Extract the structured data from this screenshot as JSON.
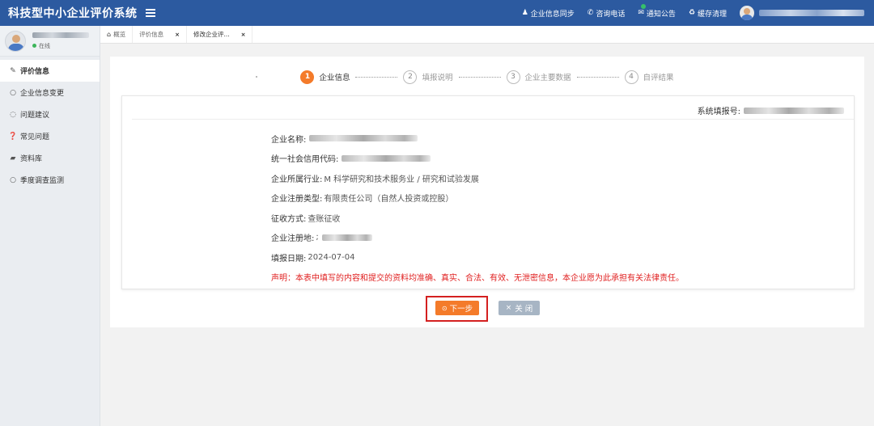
{
  "header": {
    "title": "科技型中小企业评价系统",
    "nav": [
      {
        "icon": "user-icon",
        "glyph": "♟",
        "label": "企业信息同步"
      },
      {
        "icon": "phone-icon",
        "glyph": "✆",
        "label": "咨询电话"
      },
      {
        "icon": "mail-icon",
        "glyph": "✉",
        "label": "通知公告"
      },
      {
        "icon": "refresh-icon",
        "glyph": "♻",
        "label": "缓存清理"
      }
    ]
  },
  "sidebar": {
    "status": "在线",
    "items": [
      {
        "glyph": "✎",
        "label": "评价信息"
      },
      {
        "glyph": "○",
        "label": "企业信息变更"
      },
      {
        "glyph": "◌",
        "label": "问题建议"
      },
      {
        "glyph": "❓",
        "label": "常见问题"
      },
      {
        "glyph": "▰",
        "label": "资料库"
      },
      {
        "glyph": "○",
        "label": "季度调查监测"
      }
    ]
  },
  "tabs": [
    {
      "glyph": "⌂",
      "label": "概览"
    },
    {
      "label": "评价信息",
      "close": "×"
    },
    {
      "label": "修改企业评...",
      "close": "×"
    }
  ],
  "steps": [
    {
      "num": "1",
      "label": "企业信息"
    },
    {
      "num": "2",
      "label": "填报说明"
    },
    {
      "num": "3",
      "label": "企业主要数据"
    },
    {
      "num": "4",
      "label": "自评结果"
    }
  ],
  "form": {
    "sys_no_label": "系统填报号:",
    "name_label": "企业名称:",
    "credit_code_label": "统一社会信用代码:",
    "industry_label": "企业所属行业:",
    "industry_value": "M 科学研究和技术服务业 / 研究和试验发展",
    "reg_type_label": "企业注册类型:",
    "reg_type_value": "有限责任公司（自然人投资或控股）",
    "tax_label": "征收方式:",
    "tax_value": "查账征收",
    "reg_place_label": "企业注册地:",
    "reg_place_prefix": ";",
    "date_label": "填报日期:",
    "date_value": "2024-07-04",
    "declaration": "声明：本表中填写的内容和提交的资料均准确、真实、合法、有效、无泄密信息，本企业愿为此承担有关法律责任。"
  },
  "buttons": {
    "next_glyph": "⊙",
    "next_label": "下一步",
    "close_glyph": "×",
    "close_label": "关 闭"
  },
  "colors": {
    "header_bg": "#2c5aa0",
    "accent": "#f47b2a",
    "declaration": "#e02020",
    "highlight": "#d42020"
  }
}
